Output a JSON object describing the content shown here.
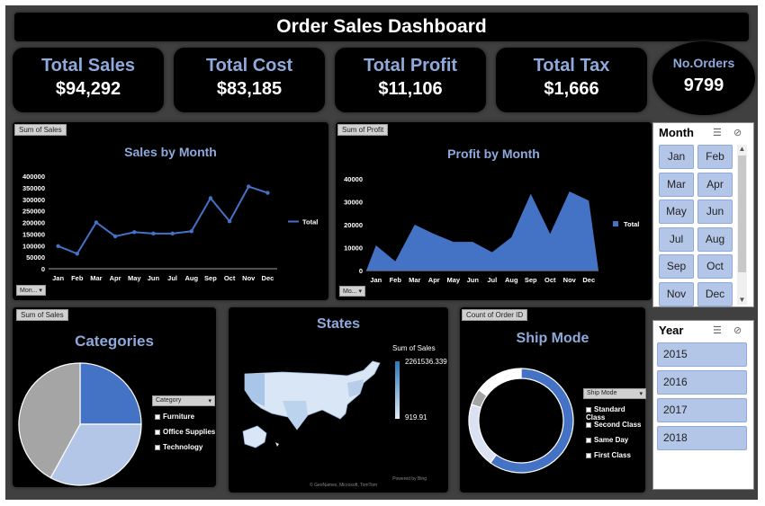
{
  "title": "Order Sales Dashboard",
  "kpis": {
    "total_sales": {
      "label": "Total Sales",
      "value": "$94,292"
    },
    "total_cost": {
      "label": "Total Cost",
      "value": "$83,185"
    },
    "total_profit": {
      "label": "Total Profit",
      "value": "$11,106"
    },
    "total_tax": {
      "label": "Total Tax",
      "value": "$1,666"
    },
    "orders": {
      "label": "No.Orders",
      "value": "9799"
    }
  },
  "sales_panel": {
    "tag": "Sum of Sales",
    "title": "Sales by Month",
    "filter": "Mon...",
    "legend": "Total"
  },
  "profit_panel": {
    "tag": "Sum of Profit",
    "title": "Profit by Month",
    "filter": "Mo...",
    "legend": "Total"
  },
  "categories_panel": {
    "tag": "Sum of Sales",
    "title": "Categories",
    "filter": "Category",
    "items": [
      "Furniture",
      "Office Supplies",
      "Technology"
    ]
  },
  "states_panel": {
    "title": "States",
    "legend_title": "Sum of Sales",
    "legend_max": "2261536.339",
    "legend_min": "919.91",
    "credit_1": "Powered by Bing",
    "credit_2": "© GeoNames, Microsoft, TomTom"
  },
  "shipmode_panel": {
    "tag": "Count of Order ID",
    "title": "Ship Mode",
    "filter": "Ship Mode",
    "items": [
      "Standard Class",
      "Second Class",
      "Same Day",
      "First Class"
    ]
  },
  "month_slicer": {
    "header": "Month",
    "items": [
      "Jan",
      "Feb",
      "Mar",
      "Apr",
      "May",
      "Jun",
      "Jul",
      "Aug",
      "Sep",
      "Oct",
      "Nov",
      "Dec"
    ]
  },
  "year_slicer": {
    "header": "Year",
    "items": [
      "2015",
      "2016",
      "2017",
      "2018"
    ]
  },
  "colors": {
    "accent": "#4472c4",
    "label": "#8ea9db",
    "light": "#b4c6e7",
    "grey": "#a5a5a5"
  },
  "chart_data": [
    {
      "type": "line",
      "title": "Sales by Month",
      "categories": [
        "Jan",
        "Feb",
        "Mar",
        "Apr",
        "May",
        "Jun",
        "Jul",
        "Aug",
        "Sep",
        "Oct",
        "Nov",
        "Dec"
      ],
      "series": [
        {
          "name": "Total",
          "values": [
            98000,
            65000,
            200000,
            140000,
            158000,
            152000,
            152000,
            162000,
            305000,
            205000,
            355000,
            328000
          ]
        }
      ],
      "yticks": [
        "0",
        "50000",
        "100000",
        "150000",
        "200000",
        "250000",
        "300000",
        "350000",
        "400000"
      ],
      "ylim": [
        0,
        400000
      ]
    },
    {
      "type": "area",
      "title": "Profit by Month",
      "categories": [
        "Jan",
        "Feb",
        "Mar",
        "Apr",
        "May",
        "Jun",
        "Jul",
        "Aug",
        "Sep",
        "Oct",
        "Nov",
        "Dec"
      ],
      "series": [
        {
          "name": "Total",
          "values": [
            11000,
            4000,
            20000,
            16000,
            12500,
            12500,
            8000,
            14500,
            33500,
            16000,
            34500,
            30500
          ]
        }
      ],
      "yticks": [
        "0",
        "10000",
        "20000",
        "30000",
        "40000"
      ],
      "ylim": [
        0,
        40000
      ]
    },
    {
      "type": "pie",
      "title": "Categories",
      "categories": [
        "Furniture",
        "Office Supplies",
        "Technology"
      ],
      "values": [
        25,
        33,
        42
      ],
      "colors": [
        "#4472c4",
        "#b4c6e7",
        "#a5a5a5"
      ]
    },
    {
      "type": "pie",
      "title": "Ship Mode",
      "categories": [
        "Standard Class",
        "Second Class",
        "Same Day",
        "First Class"
      ],
      "values": [
        60,
        20,
        5,
        15
      ],
      "colors": [
        "#4472c4",
        "#d9e1f2",
        "#a5a5a5",
        "#ffffff"
      ]
    }
  ]
}
